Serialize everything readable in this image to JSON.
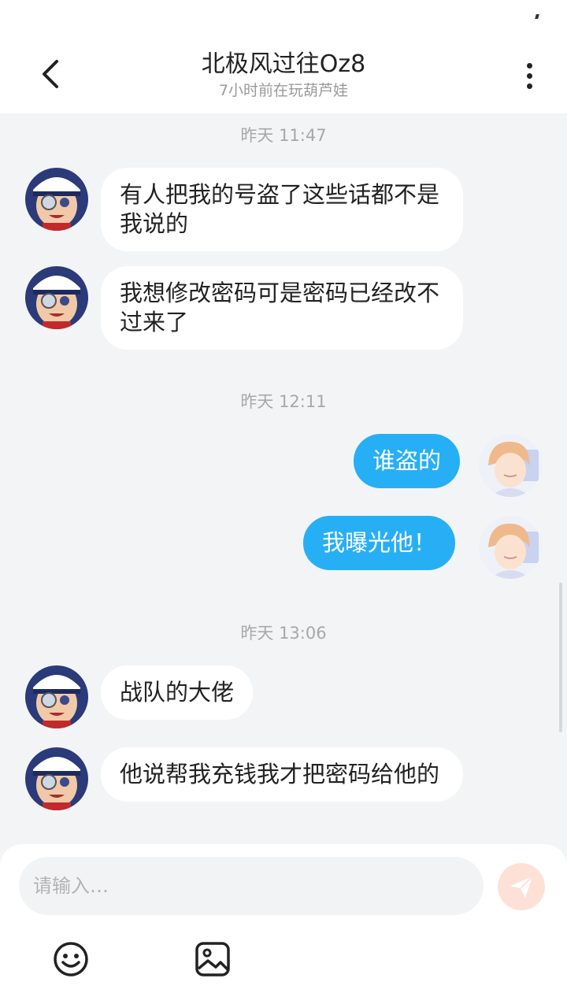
{
  "header": {
    "title": "北极风过往Oz8",
    "subtitle": "7小时前在玩葫芦娃"
  },
  "messages": [
    {
      "type": "time",
      "text": "昨天 11:47"
    },
    {
      "type": "in",
      "text": "有人把我的号盗了这些话都不是我说的"
    },
    {
      "type": "in",
      "text": "我想修改密码可是密码已经改不过来了"
    },
    {
      "type": "time",
      "text": "昨天 12:11"
    },
    {
      "type": "out",
      "text": "谁盗的"
    },
    {
      "type": "out",
      "text": "我曝光他！"
    },
    {
      "type": "time",
      "text": "昨天 13:06"
    },
    {
      "type": "in",
      "text": "战队的大佬"
    },
    {
      "type": "in",
      "text": "他说帮我充钱我才把密码给他的"
    }
  ],
  "input": {
    "placeholder": "请输入…"
  },
  "colors": {
    "outgoing_bubble": "#27aff5",
    "incoming_bubble": "#ffffff",
    "background": "#f3f4f6",
    "send_button": "#fde1d7"
  },
  "icons": {
    "back": "chevron-left-icon",
    "more": "more-vertical-icon",
    "send": "paper-plane-icon",
    "emoji": "smiley-icon",
    "image": "image-icon"
  }
}
